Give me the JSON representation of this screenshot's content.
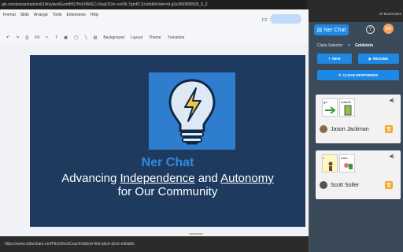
{
  "browser": {
    "url": "gle.com/presentation/d/1Wxylwz/iEum8fiS7HcF6lWECcXegO23o~esf36-7gm87JUsd/dit#slide=id.g2e3669f08505_0_2",
    "bookmarks_label": "All Bookmarks"
  },
  "slides_app": {
    "menu": [
      "Format",
      "Slide",
      "Arrange",
      "Tools",
      "Extensions",
      "Help"
    ],
    "toolbar": [
      "Fit",
      "Background",
      "Layout",
      "Theme",
      "Transition"
    ],
    "slide": {
      "title": "Ner Chat",
      "tagline_line1_pre": "Advancing ",
      "tagline_word1": "Independence",
      "tagline_mid": " and ",
      "tagline_word2": "Autonomy",
      "tagline_line2": "for Our Community"
    },
    "status_url": "https://www.slideshare.net/PitchDeckCoach/airbnb-first-pitch-deck-editable"
  },
  "panel": {
    "title": "Ner Chat",
    "avatar_initials": "BB",
    "breadcrumb": {
      "parent": "Class Selector",
      "separator": ">",
      "current": "Goldstein"
    },
    "buttons": {
      "new": "NEW",
      "resume": "RESUME",
      "clear": "CLEAR RESPONSES"
    },
    "responses": [
      {
        "symbols": [
          "go",
          "outside"
        ],
        "student": "Jason Jackman"
      },
      {
        "symbols": [
          "I",
          "want"
        ],
        "student": "Scott Soifer"
      }
    ]
  },
  "colors": {
    "slide_bg": "#1e3a5f",
    "accent_blue": "#1e88e5",
    "panel_bg": "#3b4a59",
    "trash": "#f5a623"
  }
}
